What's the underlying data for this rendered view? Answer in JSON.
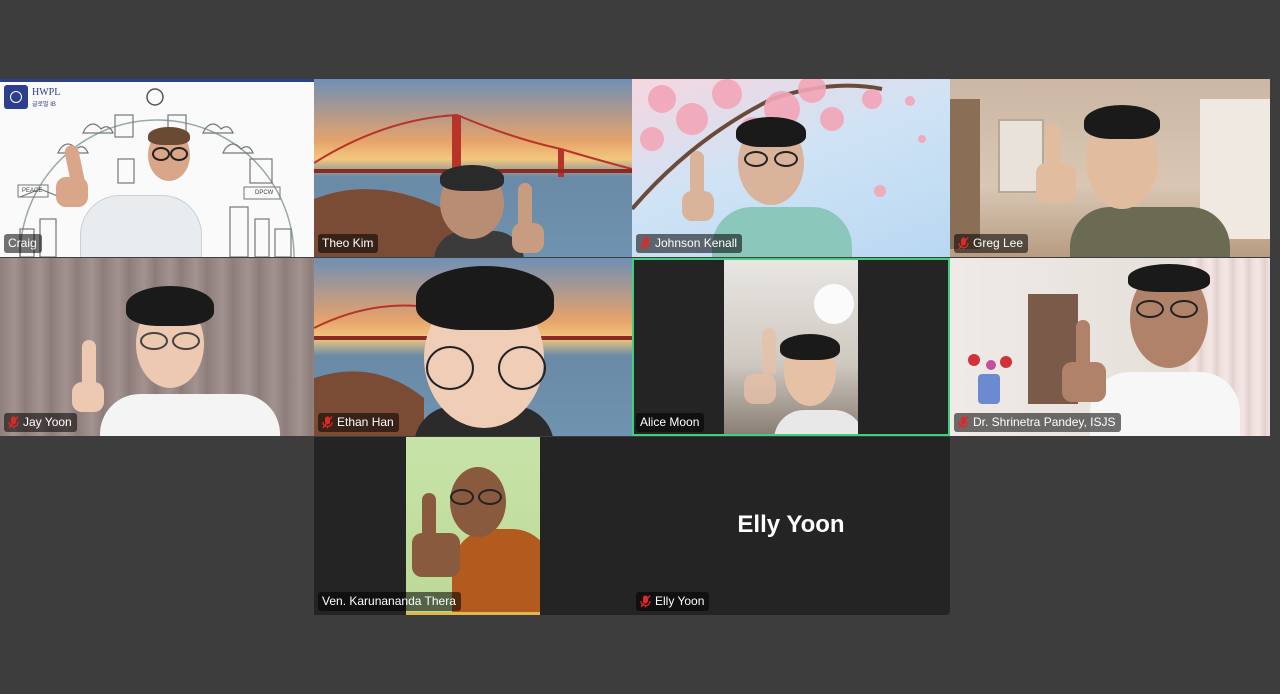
{
  "participants": [
    {
      "name": "Craig",
      "muted": false
    },
    {
      "name": "Theo Kim",
      "muted": false
    },
    {
      "name": "Johnson Kenall",
      "muted": true
    },
    {
      "name": "Greg Lee",
      "muted": true
    },
    {
      "name": "Jay Yoon",
      "muted": true
    },
    {
      "name": "Ethan Han",
      "muted": true
    },
    {
      "name": "Alice Moon",
      "muted": false
    },
    {
      "name": "Dr. Shrinetra Pandey, ISJS",
      "muted": true
    },
    {
      "name": "Ven. Karunananda Thera",
      "muted": false
    },
    {
      "name": "Elly Yoon",
      "muted": true
    }
  ],
  "active_speaker": "Alice Moon",
  "video_off_display_name": "Elly Yoon",
  "slide_text": {
    "logo": "HWPL",
    "logo_sub": "글로벌 IB",
    "peace": "PEACE",
    "dpcw": "DPCW"
  },
  "colors": {
    "background": "#3d3d3d",
    "tile": "#242424",
    "active_border": "#3ed07e",
    "muted_icon": "#e02828"
  },
  "icons": {
    "muted": "mic-muted-icon"
  }
}
